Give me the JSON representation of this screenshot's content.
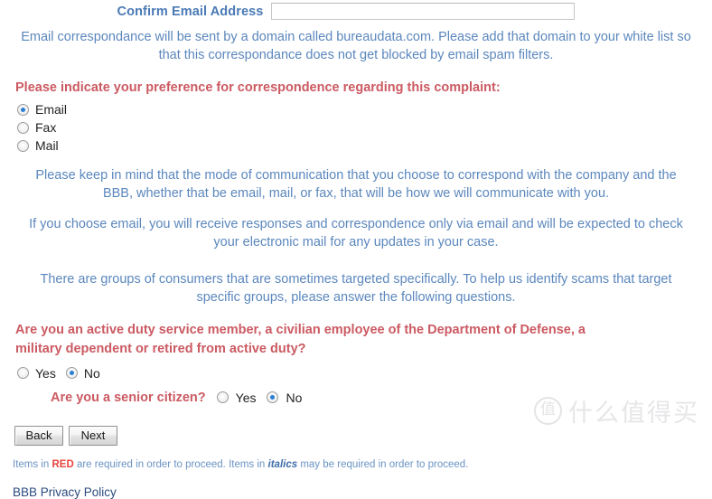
{
  "form": {
    "confirm_email": {
      "label": "Confirm Email Address",
      "value": "",
      "placeholder": ""
    },
    "email_domain_note": "Email correspondance will be sent by a domain called bureaudata.com. Please add that domain to your white list so that this correspondance does not get blocked by email spam filters.",
    "preference": {
      "heading": "Please indicate your preference for correspondence regarding this complaint:",
      "options": [
        {
          "label": "Email",
          "checked": true
        },
        {
          "label": "Fax",
          "checked": false
        },
        {
          "label": "Mail",
          "checked": false
        }
      ]
    },
    "notes": [
      "Please keep in mind that the mode of communication that you choose to correspond with the company and the BBB, whether that be email, mail, or fax, that will be how we will communicate with you.",
      "If you choose email, you will receive responses and correspondence only via email and will be expected to check your electronic mail for any updates in your case.",
      "There are groups of consumers that are sometimes targeted specifically. To help us identify scams that target specific groups, please answer the following questions."
    ],
    "active_duty": {
      "question": "Are you an active duty service member, a civilian employee of the Department of Defense, a military dependent or retired from active duty?",
      "yes_label": "Yes",
      "no_label": "No",
      "yes_checked": false,
      "no_checked": true
    },
    "senior_citizen": {
      "question": "Are you a senior citizen?",
      "yes_label": "Yes",
      "no_label": "No",
      "yes_checked": false,
      "no_checked": true
    }
  },
  "actions": {
    "back_label": "Back",
    "next_label": "Next"
  },
  "footer": {
    "note_part1": "Items in ",
    "note_red": "RED",
    "note_part2": " are required in order to proceed. Items in ",
    "note_italic": "italics",
    "note_part3": " may be required in order to proceed.",
    "privacy_link": "BBB Privacy Policy"
  },
  "watermark": {
    "badge_glyph": "值",
    "text": "什么值得买"
  },
  "colors": {
    "required_red": "#cb5a62",
    "body_blue": "#5b87bd",
    "label_blue": "#4a7ab5",
    "link_navy": "#2b4b7e",
    "radio_dot": "#2a7fd4",
    "footnote_red": "#e8443f"
  }
}
